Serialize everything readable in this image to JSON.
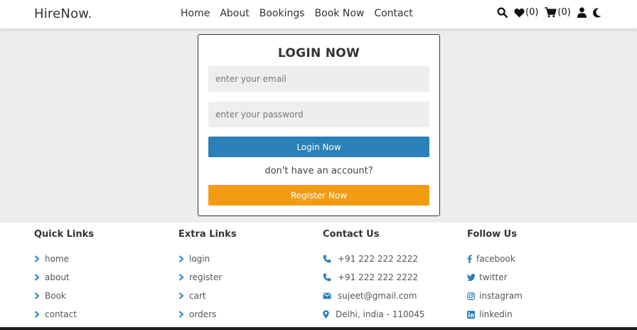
{
  "header": {
    "logo": "HireNow.",
    "nav": [
      "Home",
      "About",
      "Bookings",
      "Book Now",
      "Contact"
    ],
    "wishlist_count": "(0)",
    "cart_count": "(0)"
  },
  "login": {
    "title": "LOGIN NOW",
    "email_placeholder": "enter your email",
    "password_placeholder": "enter your password",
    "login_button": "Login Now",
    "no_account_text": "don't have an account?",
    "register_button": "Register Now"
  },
  "footer": {
    "quick_links": {
      "title": "Quick Links",
      "items": [
        "home",
        "about",
        "Book",
        "contact"
      ]
    },
    "extra_links": {
      "title": "Extra Links",
      "items": [
        "login",
        "register",
        "cart",
        "orders"
      ]
    },
    "contact": {
      "title": "Contact Us",
      "items": [
        {
          "icon": "phone-icon",
          "text": "+91 222 222 2222"
        },
        {
          "icon": "phone-icon",
          "text": "+91 222 222 2222"
        },
        {
          "icon": "envelope-icon",
          "text": "sujeet@gmail.com"
        },
        {
          "icon": "map-marker-icon",
          "text": "Delhi, india - 110045"
        }
      ]
    },
    "follow": {
      "title": "Follow Us",
      "items": [
        {
          "icon": "facebook-icon",
          "text": "facebook"
        },
        {
          "icon": "twitter-icon",
          "text": "twitter"
        },
        {
          "icon": "instagram-icon",
          "text": "instagram"
        },
        {
          "icon": "linkedin-icon",
          "text": "linkedin"
        }
      ]
    }
  },
  "colors": {
    "primary": "#2a80b9",
    "accent": "#f39c12",
    "background": "#ededed"
  }
}
